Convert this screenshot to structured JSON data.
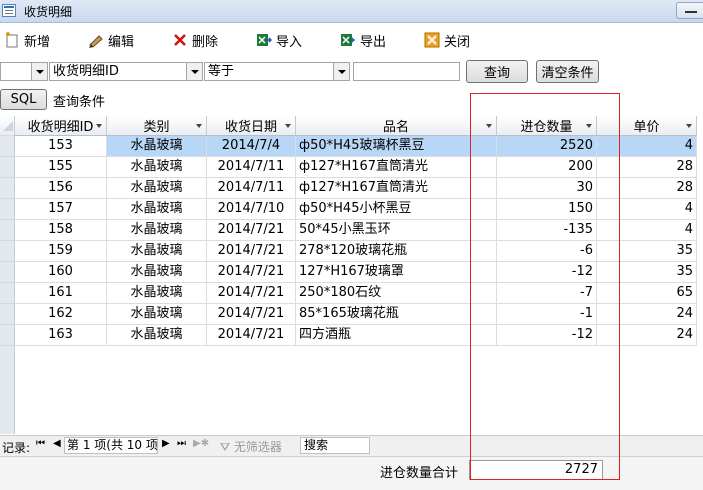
{
  "window": {
    "title": "收货明细"
  },
  "toolbar": {
    "new_label": "新增",
    "edit_label": "编辑",
    "delete_label": "删除",
    "import_label": "导入",
    "export_label": "导出",
    "close_label": "关闭"
  },
  "filter": {
    "field_value": "收货明细ID",
    "operator_value": "等于",
    "value": "",
    "query_label": "查询",
    "clear_label": "清空条件",
    "sql_label": "SQL",
    "condition_label": "查询条件"
  },
  "table": {
    "columns": [
      "收货明细ID",
      "类别",
      "收货日期",
      "品名",
      "进仓数量",
      "单价"
    ],
    "rows": [
      [
        "153",
        "水晶玻璃",
        "2014/7/4",
        "ф50*H45玻璃杯黑豆",
        "2520",
        "4"
      ],
      [
        "155",
        "水晶玻璃",
        "2014/7/11",
        "ф127*H167直筒清光",
        "200",
        "28"
      ],
      [
        "156",
        "水晶玻璃",
        "2014/7/11",
        "ф127*H167直筒清光",
        "30",
        "28"
      ],
      [
        "157",
        "水晶玻璃",
        "2014/7/10",
        "ф50*H45小杯黑豆",
        "150",
        "4"
      ],
      [
        "158",
        "水晶玻璃",
        "2014/7/21",
        "50*45小黑玉环",
        "-135",
        "4"
      ],
      [
        "159",
        "水晶玻璃",
        "2014/7/21",
        "278*120玻璃花瓶",
        "-6",
        "35"
      ],
      [
        "160",
        "水晶玻璃",
        "2014/7/21",
        "127*H167玻璃罩",
        "-12",
        "35"
      ],
      [
        "161",
        "水晶玻璃",
        "2014/7/21",
        "250*180石纹",
        "-7",
        "65"
      ],
      [
        "162",
        "水晶玻璃",
        "2014/7/21",
        "85*165玻璃花瓶",
        "-1",
        "24"
      ],
      [
        "163",
        "水晶玻璃",
        "2014/7/21",
        "四方酒瓶",
        "-12",
        "24"
      ]
    ]
  },
  "nav": {
    "record_label": "记录:",
    "position_label": "第 1 项(共 10 项",
    "filter_label": "无筛选器",
    "search_label": "搜索"
  },
  "footer": {
    "total_label": "进仓数量合计",
    "total_value": "2727"
  },
  "colors": {
    "selected_row": "#b8d6f5",
    "highlight_box": "#e02020"
  }
}
